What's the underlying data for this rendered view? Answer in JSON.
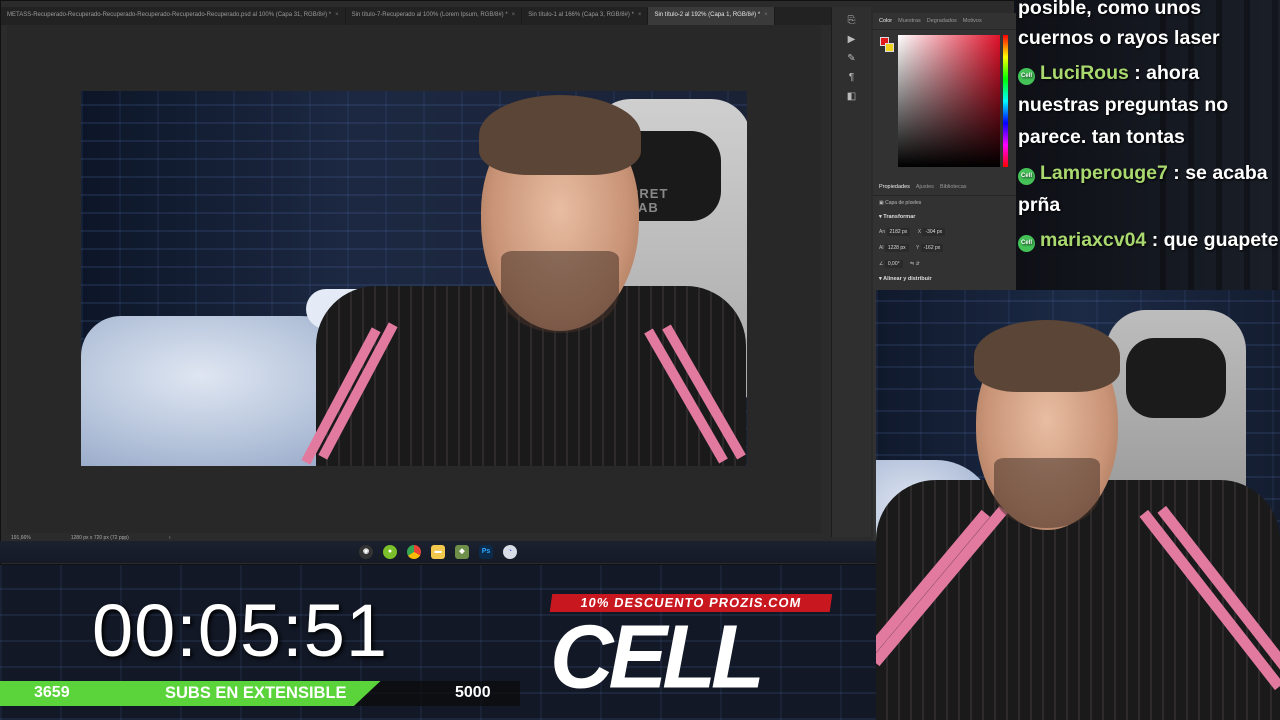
{
  "photoshop": {
    "tabs": [
      {
        "label": "METASS-Recuperado-Recuperado-Recuperado-Recuperado-Recuperado-Recuperado.psd al 100% (Capa 31, RGB/8#) *",
        "active": false
      },
      {
        "label": "Sin título-7-Recuperado al 100% (Lorem Ipsum, RGB/8#) *",
        "active": false
      },
      {
        "label": "Sin título-1 al 166% (Capa 3, RGB/8#) *",
        "active": false
      },
      {
        "label": "Sin título-2 al 192% (Capa 1, RGB/8#) *",
        "active": true
      }
    ],
    "tab_close": "×",
    "status": {
      "zoom": "191,66%",
      "doc_size": "1280 px x 720 px (72 ppp)",
      "arrow": "›"
    },
    "color_panel_tabs": [
      "Color",
      "Muestras",
      "Degradados",
      "Motivos"
    ],
    "fg_color": "#e01a1a",
    "bg_color": "#f1d21a",
    "props_tabs": [
      "Propiedades",
      "Ajustes",
      "Bibliotecas"
    ],
    "layer_type": "Capa de píxeles",
    "transform_title": "Transformar",
    "width_label": "An",
    "width_value": "2182 px",
    "height_label": "Al",
    "height_value": "1228 px",
    "x_label": "X",
    "x_value": "-304 px",
    "y_label": "Y",
    "y_value": "-162 px",
    "angle_value": "0,00°",
    "align_title": "Alinear y distribuir",
    "align_sub": "Alin",
    "canvas_chair_text": "CRET\nLAB",
    "taskbar_icons": [
      "obs-icon",
      "green-app-icon",
      "chrome-icon",
      "folder-icon",
      "app-icon",
      "photoshop-icon",
      "discord-icon"
    ]
  },
  "chat": {
    "messages": [
      {
        "user": "",
        "text": "posible, como unos"
      },
      {
        "user": "",
        "text": "cuernos o rayos laser"
      },
      {
        "user": "LuciRous",
        "text": ": ahora nuestras preguntas no parece. tan tontas"
      },
      {
        "user": "Lamperouge7",
        "text": ": se acaba prña"
      },
      {
        "user": "mariaxcv04",
        "text": ": que guapete"
      }
    ]
  },
  "overlay": {
    "timer": "00:05:51",
    "goal_current": "3659",
    "goal_label": "SUBS EN EXTENSIBLE",
    "goal_target": "5000",
    "goal_progress": 0.7318,
    "promo_text": "10% DESCUENTO PROZIS.COM",
    "brand": "CELL",
    "accent_green": "#5bd33b",
    "accent_red": "#c8171f"
  }
}
